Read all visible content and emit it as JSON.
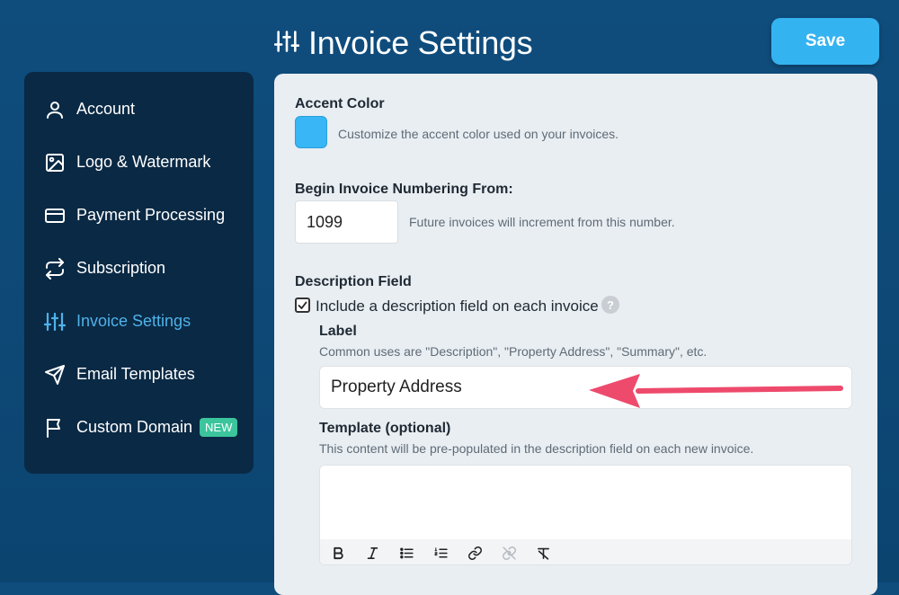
{
  "header": {
    "title": "Invoice Settings",
    "icon": "sliders-icon"
  },
  "save_button": {
    "label": "Save"
  },
  "sidebar": {
    "items": [
      {
        "label": "Account",
        "icon": "user-icon",
        "active": false
      },
      {
        "label": "Logo & Watermark",
        "icon": "image-icon",
        "active": false
      },
      {
        "label": "Payment Processing",
        "icon": "credit-card-icon",
        "active": false
      },
      {
        "label": "Subscription",
        "icon": "repeat-icon",
        "active": false
      },
      {
        "label": "Invoice Settings",
        "icon": "sliders-icon",
        "active": true
      },
      {
        "label": "Email Templates",
        "icon": "send-icon",
        "active": false
      },
      {
        "label": "Custom Domain",
        "icon": "flag-icon",
        "active": false,
        "badge": "NEW"
      }
    ]
  },
  "settings": {
    "accent": {
      "label": "Accent Color",
      "hint": "Customize the accent color used on your invoices.",
      "value": "#38b6f5"
    },
    "numbering": {
      "label": "Begin Invoice Numbering From:",
      "value": "1099",
      "hint": "Future invoices will increment from this number."
    },
    "description": {
      "label": "Description Field",
      "checkbox_label": "Include a description field on each invoice",
      "checked": true,
      "help": "?",
      "field_label": "Label",
      "field_hint": "Common uses are \"Description\", \"Property Address\", \"Summary\", etc.",
      "field_value": "Property Address",
      "template_label": "Template (optional)",
      "template_hint": "This content will be pre-populated in the description field on each new invoice.",
      "template_value": ""
    }
  },
  "editor_toolbar": [
    "bold-icon",
    "italic-icon",
    "bulleted-list-icon",
    "numbered-list-icon",
    "link-icon",
    "unlink-icon",
    "clear-format-icon"
  ],
  "colors": {
    "background": "#0f4d7d",
    "sidebar": "#0a2944",
    "accent": "#34b3f1",
    "active": "#4fb2ea",
    "badge": "#3cc59c",
    "arrow": "#ee4a6c"
  }
}
